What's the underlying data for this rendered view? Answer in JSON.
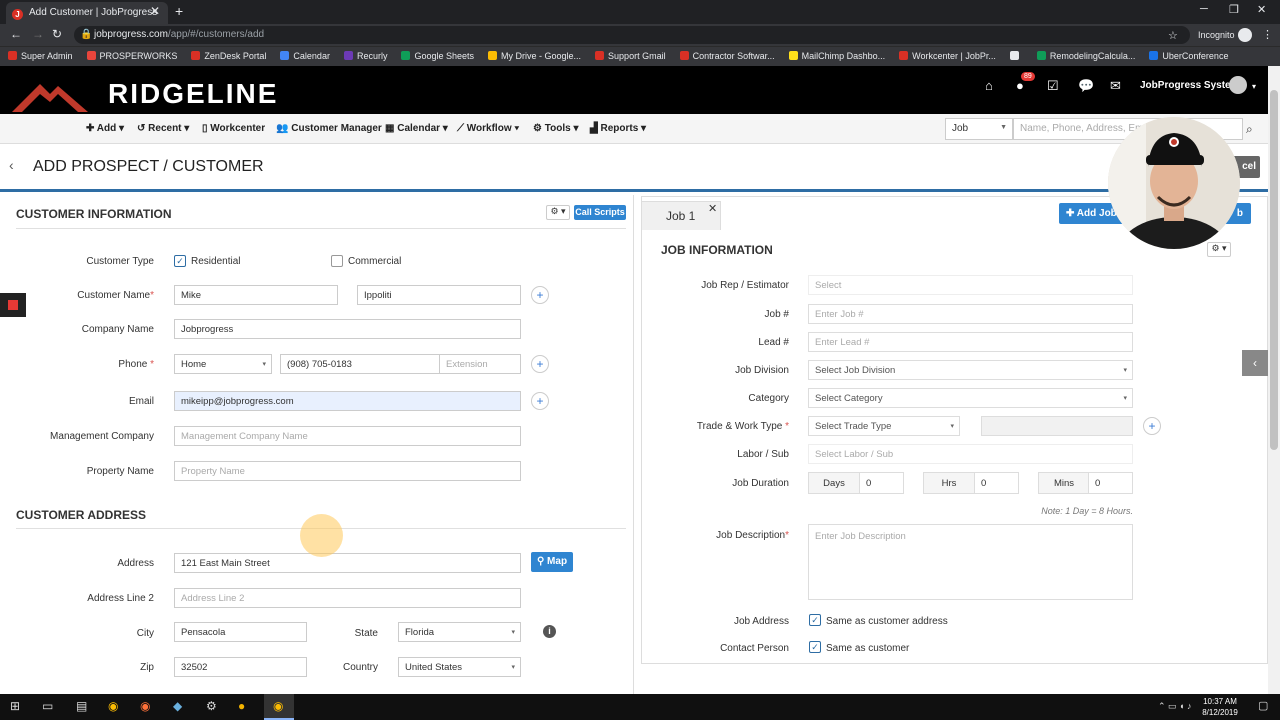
{
  "browser": {
    "tab_title": "Add Customer | JobProgress",
    "tab_icon": "J",
    "url_host": "jobprogress.com",
    "url_path": "/app/#/customers/add",
    "incognito_label": "Incognito",
    "bookmarks": [
      {
        "label": "Super Admin",
        "color": "#d93025"
      },
      {
        "label": "PROSPERWORKS",
        "color": "#e8453c"
      },
      {
        "label": "ZenDesk Portal",
        "color": "#d93025"
      },
      {
        "label": "Calendar",
        "color": "#4285f4"
      },
      {
        "label": "Recurly",
        "color": "#6c3ab5"
      },
      {
        "label": "Google Sheets",
        "color": "#0f9d58"
      },
      {
        "label": "My Drive - Google...",
        "color": "#fbbc04"
      },
      {
        "label": "Support Gmail",
        "color": "#d93025"
      },
      {
        "label": "Contractor Softwar...",
        "color": "#d93025"
      },
      {
        "label": "MailChimp Dashbo...",
        "color": "#ffe01b"
      },
      {
        "label": "Workcenter | JobPr...",
        "color": "#d93025"
      },
      {
        "label": "",
        "color": "#e8eaed"
      },
      {
        "label": "RemodelingCalcula...",
        "color": "#0f9d58"
      },
      {
        "label": "UberConference",
        "color": "#1a73e8"
      }
    ]
  },
  "header": {
    "brand": "RIDGELINE",
    "notification_count": "89",
    "user_name": "JobProgress System"
  },
  "menu": {
    "items": [
      "Add",
      "Recent",
      "Workcenter",
      "Customer Manager",
      "Calendar",
      "Workflow",
      "Tools",
      "Reports"
    ],
    "search_scope": "Job",
    "search_placeholder": "Name, Phone, Address, Em"
  },
  "page": {
    "title": "ADD PROSPECT / CUSTOMER",
    "cancel_label": "cel"
  },
  "customer_info": {
    "heading": "CUSTOMER INFORMATION",
    "call_scripts": "Call Scripts",
    "customer_type_label": "Customer Type",
    "residential": "Residential",
    "commercial": "Commercial",
    "customer_name_label": "Customer Name",
    "first_name": "Mike",
    "last_name": "Ippoliti",
    "company_name_label": "Company Name",
    "company_name": "Jobprogress",
    "phone_label": "Phone",
    "phone_type": "Home",
    "phone_number": "(908) 705-0183",
    "extension_placeholder": "Extension",
    "email_label": "Email",
    "email": "mikeipp@jobprogress.com",
    "management_label": "Management Company",
    "management_placeholder": "Management Company Name",
    "property_label": "Property Name",
    "property_placeholder": "Property Name"
  },
  "customer_address": {
    "heading": "CUSTOMER ADDRESS",
    "address_label": "Address",
    "address": "121 East Main Street",
    "map_label": "Map",
    "line2_label": "Address Line 2",
    "line2_placeholder": "Address Line 2",
    "city_label": "City",
    "city": "Pensacola",
    "state_label": "State",
    "state": "Florida",
    "zip_label": "Zip",
    "zip": "32502",
    "country_label": "Country",
    "country": "United States"
  },
  "job": {
    "tab_label": "Job 1",
    "add_job": "Add Job",
    "add_job_right": "b",
    "heading": "JOB INFORMATION",
    "rep_label": "Job Rep / Estimator",
    "rep_placeholder": "Select",
    "jobno_label": "Job #",
    "jobno_placeholder": "Enter Job #",
    "lead_label": "Lead #",
    "lead_placeholder": "Enter Lead #",
    "division_label": "Job Division",
    "division_placeholder": "Select Job Division",
    "category_label": "Category",
    "category_placeholder": "Select Category",
    "trade_label": "Trade & Work Type",
    "trade_placeholder": "Select Trade Type",
    "labor_label": "Labor / Sub",
    "labor_placeholder": "Select Labor / Sub",
    "duration_label": "Job Duration",
    "days_label": "Days",
    "days": "0",
    "hrs_label": "Hrs",
    "hrs": "0",
    "mins_label": "Mins",
    "mins": "0",
    "duration_note": "Note: 1 Day = 8 Hours.",
    "desc_label": "Job Description",
    "desc_placeholder": "Enter Job Description",
    "address_label": "Job Address",
    "same_address": "Same as customer address",
    "contact_label": "Contact Person",
    "same_customer": "Same as customer"
  },
  "taskbar": {
    "time": "10:37 AM",
    "date": "8/12/2019"
  }
}
